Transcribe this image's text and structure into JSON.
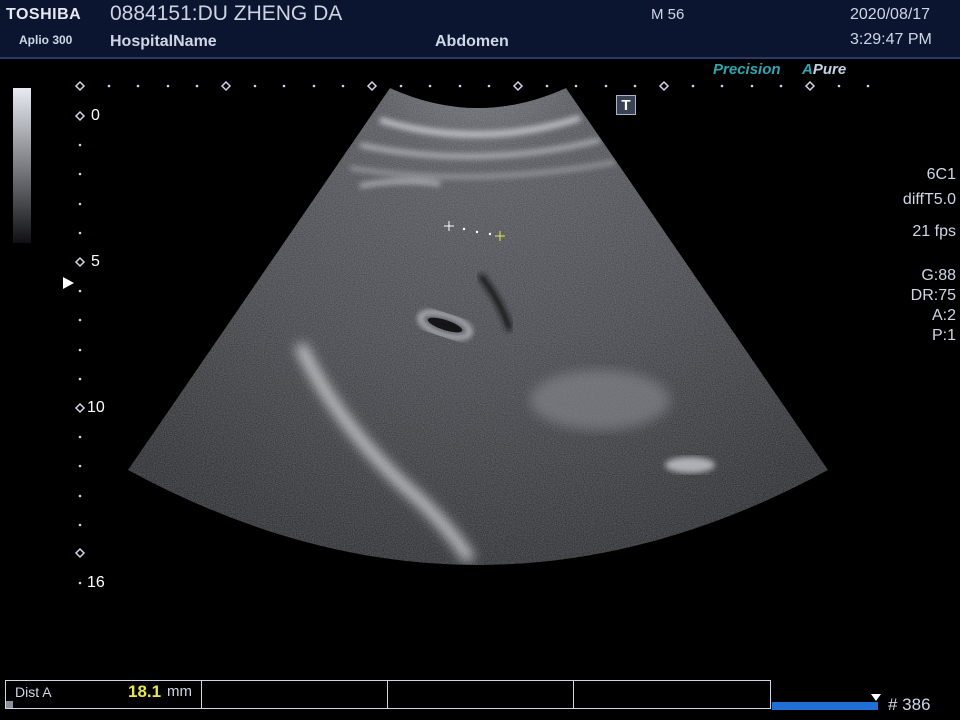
{
  "header": {
    "brand": "TOSHIBA",
    "model": "Aplio 300",
    "patient": "0884151:DU ZHENG DA",
    "hospital": "HospitalName",
    "exam": "Abdomen",
    "sex_age": "M 56",
    "date": "2020/08/17",
    "time": "3:29:47 PM"
  },
  "image_mode": {
    "precision_label_1": "P",
    "precision_label_2": "recision",
    "apure_a": "A",
    "apure_label": "Pure",
    "t_icon": "T"
  },
  "depth_scale": {
    "labels": [
      "0",
      "5",
      "10",
      "16"
    ]
  },
  "params": {
    "probe": "6C1",
    "preset": "diffT5.0",
    "fps": "21 fps",
    "gain": "G:88",
    "dynamic_range": "DR:75",
    "a": "A:2",
    "p": "P:1"
  },
  "measurement": {
    "label": "Dist A",
    "value": "18.1",
    "unit": "mm"
  },
  "cine": {
    "frame_count": "# 386"
  },
  "colors": {
    "header_bg": "#0c1530",
    "accent_teal": "#2fa6b0",
    "measurement_value": "#e8e84a",
    "cine_bar": "#1f6fd6"
  }
}
